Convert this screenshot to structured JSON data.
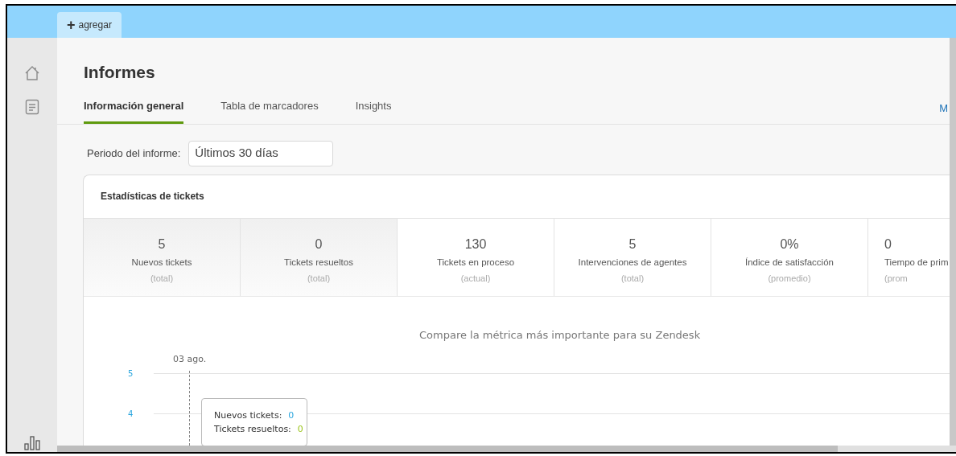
{
  "top_bar": {
    "add_tab": {
      "icon": "+",
      "label": "agregar"
    }
  },
  "page": {
    "title": "Informes",
    "tabs": [
      {
        "label": "Información general",
        "selected": true
      },
      {
        "label": "Tabla de marcadores",
        "selected": false
      },
      {
        "label": "Insights",
        "selected": false
      }
    ],
    "right_link": "M",
    "period": {
      "label": "Periodo del informe:",
      "value": "Últimos 30 días"
    }
  },
  "card": {
    "title": "Estadísticas de tickets",
    "stats": [
      {
        "value": "5",
        "label": "Nuevos tickets",
        "sub": "(total)",
        "selected": true
      },
      {
        "value": "0",
        "label": "Tickets resueltos",
        "sub": "(total)",
        "selected": true
      },
      {
        "value": "130",
        "label": "Tickets en proceso",
        "sub": "(actual)",
        "selected": false
      },
      {
        "value": "5",
        "label": "Intervenciones de agentes",
        "sub": "(total)",
        "selected": false
      },
      {
        "value": "0%",
        "label": "Índice de satisfacción",
        "sub": "(promedio)",
        "selected": false
      },
      {
        "value": "0",
        "label": "Tiempo de prim",
        "sub": "(prom",
        "selected": false
      }
    ],
    "chart": {
      "title": "Compare la métrica más importante para su Zendesk",
      "date_label": "03 ago.",
      "y_ticks": [
        "5",
        "4"
      ],
      "tooltip": [
        {
          "label": "Nuevos tickets:",
          "value": "0",
          "color": "#2ba6de"
        },
        {
          "label": "Tickets resueltos:",
          "value": "0",
          "color": "#9bc41c"
        }
      ]
    }
  }
}
